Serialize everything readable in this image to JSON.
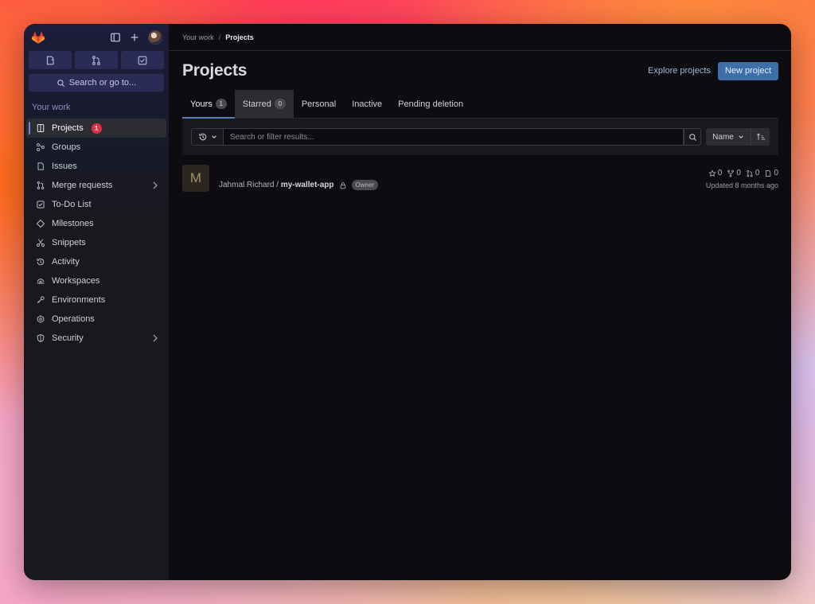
{
  "sidebar": {
    "quick_actions": [
      {
        "icon": "issue-icon"
      },
      {
        "icon": "merge-request-icon"
      },
      {
        "icon": "todo-icon"
      }
    ],
    "search_label": "Search or go to...",
    "section_title": "Your work",
    "items": [
      {
        "label": "Projects",
        "icon": "project-icon",
        "badge": "1",
        "active": true
      },
      {
        "label": "Groups",
        "icon": "group-icon"
      },
      {
        "label": "Issues",
        "icon": "issue-icon"
      },
      {
        "label": "Merge requests",
        "icon": "merge-request-icon",
        "has_chevron": true
      },
      {
        "label": "To-Do List",
        "icon": "todo-icon"
      },
      {
        "label": "Milestones",
        "icon": "milestone-icon"
      },
      {
        "label": "Snippets",
        "icon": "snippet-icon"
      },
      {
        "label": "Activity",
        "icon": "history-icon"
      },
      {
        "label": "Workspaces",
        "icon": "workspace-icon"
      },
      {
        "label": "Environments",
        "icon": "environment-icon"
      },
      {
        "label": "Operations",
        "icon": "operations-icon"
      },
      {
        "label": "Security",
        "icon": "shield-icon",
        "has_chevron": true
      }
    ]
  },
  "breadcrumb": {
    "parent": "Your work",
    "separator": "/",
    "current": "Projects"
  },
  "header": {
    "title": "Projects",
    "explore_label": "Explore projects",
    "new_label": "New project"
  },
  "tabs": [
    {
      "label": "Yours",
      "count": "1",
      "active": true
    },
    {
      "label": "Starred",
      "count": "0"
    },
    {
      "label": "Personal"
    },
    {
      "label": "Inactive"
    },
    {
      "label": "Pending deletion"
    }
  ],
  "filter": {
    "placeholder": "Search or filter results...",
    "sort_label": "Name"
  },
  "projects": [
    {
      "avatar_letter": "M",
      "namespace": "Jahmal Richard",
      "separator": " / ",
      "name": "my-wallet-app",
      "role": "Owner",
      "stars": "0",
      "forks": "0",
      "merge_requests": "0",
      "issues": "0",
      "updated": "Updated 8 months ago"
    }
  ],
  "colors": {
    "accent": "#3c6fa8",
    "badge_red": "#dd3245",
    "sidebar_bg": "#18181d",
    "main_bg": "#0d0d11"
  }
}
